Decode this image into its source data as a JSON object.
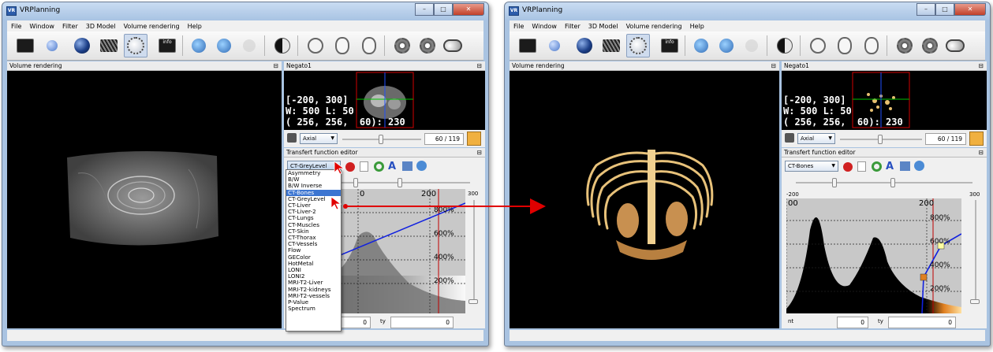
{
  "windows": [
    {
      "title": "VRPlanning",
      "menu": [
        "File",
        "Window",
        "Filter",
        "3D Model",
        "Volume rendering",
        "Help"
      ],
      "panels": {
        "volume": "Volume rendering",
        "negato": "Negato1",
        "tfe": "Transfert function editor"
      },
      "negato": {
        "line1": "[-200, 300]",
        "line2": "W: 500 L: 50",
        "line3": "( 256, 256,  60): 230",
        "view": "Axial",
        "slice": "60 / 119"
      },
      "tf_selected": "CT-GreyLevel",
      "dropdown_options": [
        "Asymmetry",
        "B/W",
        "B/W Inverse",
        "CT-Bones",
        "CT-GreyLevel",
        "CT-Liver",
        "CT-Liver-2",
        "CT-Lungs",
        "CT-Muscles",
        "CT-Skin",
        "CT-Thorax",
        "CT-Vessels",
        "Flow",
        "GEColor",
        "HotMetal",
        "LONI",
        "LONI2",
        "MRI-T2-Liver",
        "MRI-T2-kidneys",
        "MRI-T2-vessels",
        "P-Value",
        "Spectrum"
      ],
      "highlighted": "CT-Bones",
      "graph": {
        "x_labels": [
          "0",
          "200"
        ],
        "right_label": "300",
        "y_labels": [
          "800%",
          "600%",
          "400%",
          "200%"
        ]
      },
      "fields": {
        "a": "0",
        "b_label": "ty",
        "b": "0"
      }
    },
    {
      "title": "VRPlanning",
      "menu": [
        "File",
        "Window",
        "Filter",
        "3D Model",
        "Volume rendering",
        "Help"
      ],
      "panels": {
        "volume": "Volume rendering",
        "negato": "Negato1",
        "tfe": "Transfert function editor"
      },
      "negato": {
        "line1": "[-200, 300]",
        "line2": "W: 500 L: 50",
        "line3": "( 256, 256,  60): 230",
        "view": "Axial",
        "slice": "60 / 119"
      },
      "tf_selected": "CT-Bones",
      "graph": {
        "left_label": "-200",
        "x_labels": [
          "00",
          "200"
        ],
        "right_label": "300",
        "y_labels": [
          "800%",
          "600%",
          "400%",
          "200%"
        ]
      },
      "fields": {
        "a_label": "nt",
        "a": "0",
        "b_label": "ty",
        "b": "0"
      }
    }
  ],
  "colors": {
    "arrow": "#e00000",
    "curve": "#1020e0",
    "titlebar": "#bcd3ee"
  }
}
